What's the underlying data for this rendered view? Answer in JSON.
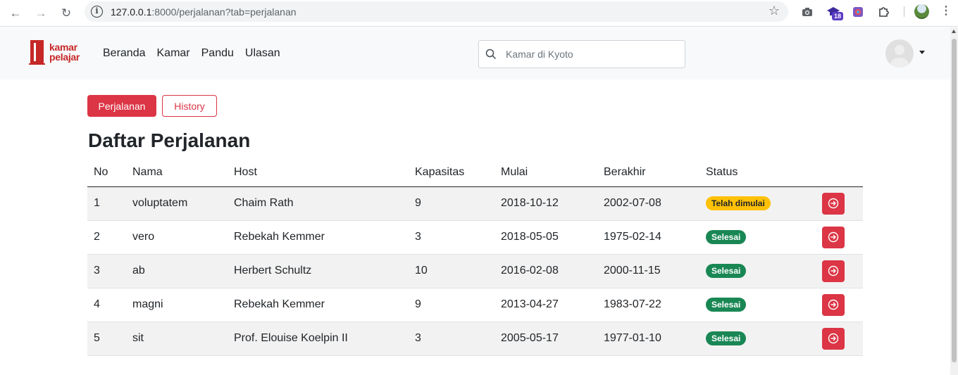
{
  "browser": {
    "url_host": "127.0.0.1",
    "url_rest": ":8000/perjalanan?tab=perjalanan",
    "extension_badge": "18"
  },
  "navbar": {
    "logo_line1": "kamar",
    "logo_line2": "pelajar",
    "menu": [
      "Beranda",
      "Kamar",
      "Pandu",
      "Ulasan"
    ],
    "search_placeholder": "Kamar di Kyoto"
  },
  "tabs": {
    "active_label": "Perjalanan",
    "history_label": "History"
  },
  "page_title": "Daftar Perjalanan",
  "table": {
    "headers": [
      "No",
      "Nama",
      "Host",
      "Kapasitas",
      "Mulai",
      "Berakhir",
      "Status"
    ],
    "rows": [
      {
        "no": "1",
        "nama": "voluptatem",
        "host": "Chaim Rath",
        "kapasitas": "9",
        "mulai": "2018-10-12",
        "berakhir": "2002-07-08",
        "status": "Telah dimulai",
        "status_color": "#ffc107"
      },
      {
        "no": "2",
        "nama": "vero",
        "host": "Rebekah Kemmer",
        "kapasitas": "3",
        "mulai": "2018-05-05",
        "berakhir": "1975-02-14",
        "status": "Selesai",
        "status_color": "#198754"
      },
      {
        "no": "3",
        "nama": "ab",
        "host": "Herbert Schultz",
        "kapasitas": "10",
        "mulai": "2016-02-08",
        "berakhir": "2000-11-15",
        "status": "Selesai",
        "status_color": "#198754"
      },
      {
        "no": "4",
        "nama": "magni",
        "host": "Rebekah Kemmer",
        "kapasitas": "9",
        "mulai": "2013-04-27",
        "berakhir": "1983-07-22",
        "status": "Selesai",
        "status_color": "#198754"
      },
      {
        "no": "5",
        "nama": "sit",
        "host": "Prof. Elouise Koelpin II",
        "kapasitas": "3",
        "mulai": "2005-05-17",
        "berakhir": "1977-01-10",
        "status": "Selesai",
        "status_color": "#198754"
      }
    ]
  },
  "colors": {
    "brand": "#dc3545",
    "navbar_bg": "#f8f9fa"
  }
}
